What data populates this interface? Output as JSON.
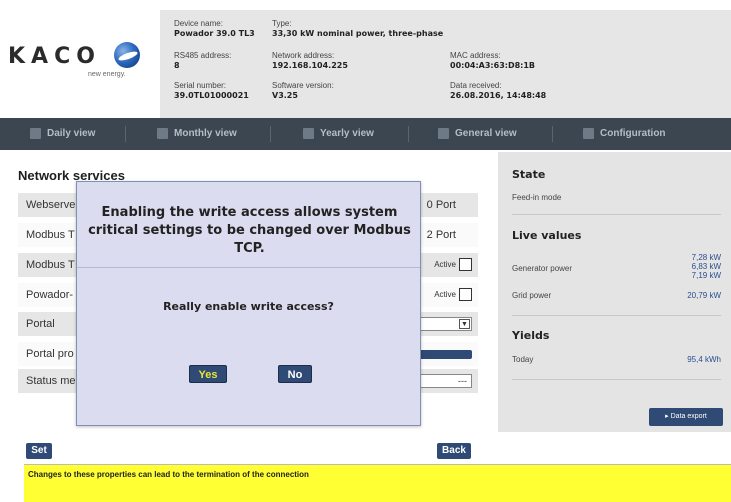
{
  "brand": {
    "name": "KACO",
    "tagline": "new energy."
  },
  "device_info": {
    "device_name_label": "Device name:",
    "device_name": "Powador 39.0 TL3",
    "type_label": "Type:",
    "type": "33,30 kW nominal power, three-phase",
    "rs485_label": "RS485 address:",
    "rs485": "8",
    "network_label": "Network address:",
    "network": "192.168.104.225",
    "mac_label": "MAC address:",
    "mac": "00:04:A3:63:D8:1B",
    "serial_label": "Serial number:",
    "serial": "39.0TL01000021",
    "software_label": "Software version:",
    "software": "V3.25",
    "data_label": "Data received:",
    "data_received": "26.08.2016, 14:48:48"
  },
  "nav": {
    "items": [
      {
        "label": "Daily view",
        "icon": "calendar-day-icon"
      },
      {
        "label": "Monthly view",
        "icon": "calendar-month-icon"
      },
      {
        "label": "Yearly view",
        "icon": "calendar-year-icon"
      },
      {
        "label": "General view",
        "icon": "overview-icon"
      },
      {
        "label": "Configuration",
        "icon": "configuration-icon"
      }
    ]
  },
  "main": {
    "title": "Network services",
    "rows": [
      {
        "label": "Webserve",
        "port": "0 Port"
      },
      {
        "label": "Modbus T",
        "port": "2 Port"
      },
      {
        "label": "Modbus T",
        "active": "Active"
      },
      {
        "label": "Powador-",
        "active": "Active"
      },
      {
        "label": "Portal"
      },
      {
        "label": "Portal pro"
      },
      {
        "label": "Status me",
        "value": "---"
      }
    ],
    "set_button": "Set",
    "back_button": "Back"
  },
  "state_panel": {
    "state_title": "State",
    "state_value": "Feed-in mode",
    "live_title": "Live values",
    "generator_label": "Generator power",
    "generator_values": [
      "7,28 kW",
      "6,83 kW",
      "7,19 kW"
    ],
    "grid_label": "Grid power",
    "grid_value": "20,79 kW",
    "yields_title": "Yields",
    "today_label": "Today",
    "today_value": "95,4 kWh",
    "export_button": "▸ Data export"
  },
  "warning": {
    "text": "Changes to these properties can lead to the termination of the connection"
  },
  "modal": {
    "message": "Enabling the write access allows system critical settings to be changed over Modbus TCP.",
    "question": "Really enable write access?",
    "yes": "Yes",
    "no": "No"
  },
  "colors": {
    "nav_bg": "#3c4650",
    "button_blue": "#2f4a74",
    "warning_yellow": "#ffff33",
    "modal_bg": "#dcdcf0",
    "value_blue": "#2a4d8f"
  }
}
